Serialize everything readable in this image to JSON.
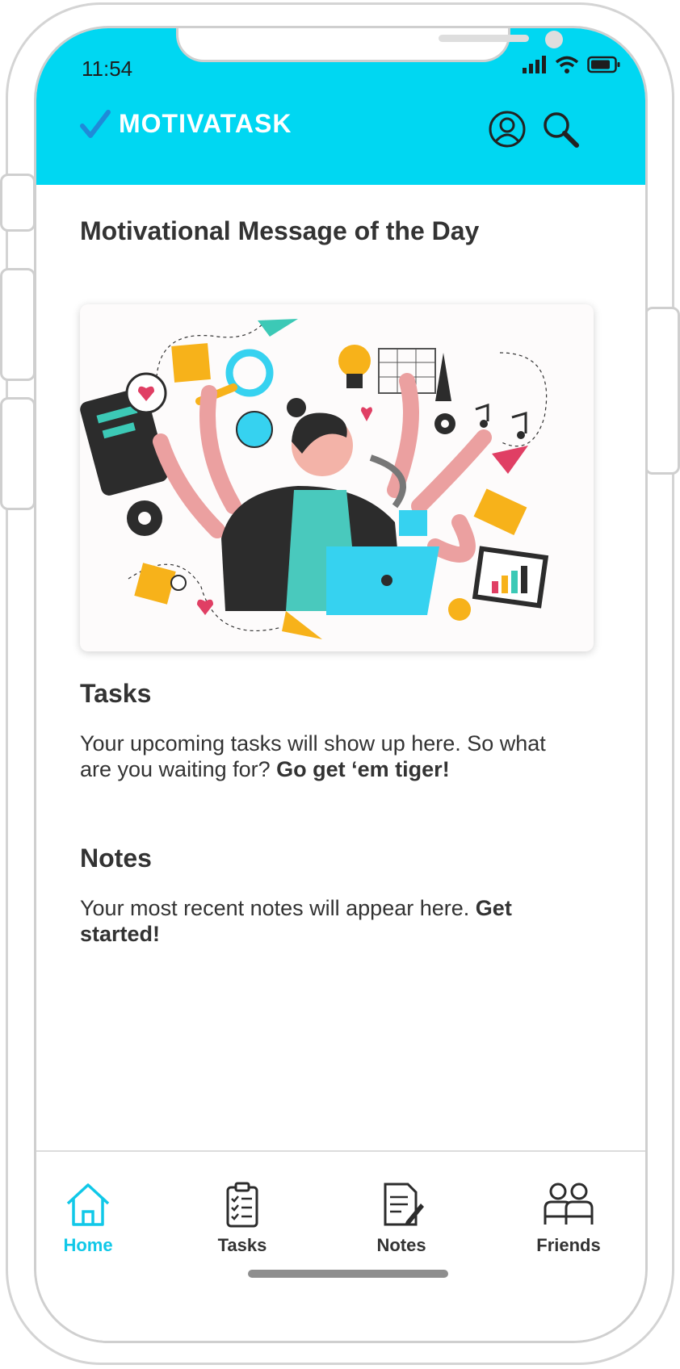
{
  "status_bar": {
    "time": "11:54"
  },
  "header": {
    "brand": "MOTIVATASK",
    "profile_icon": "user-circle-icon",
    "search_icon": "search-icon"
  },
  "main": {
    "motd_title": "Motivational Message of the Day",
    "illustration": "multitasking-woman-illustration",
    "tasks": {
      "title": "Tasks",
      "text": "Your upcoming tasks will show up here. So what are you waiting for?",
      "emphasis": "Go get ‘em tiger!"
    },
    "notes": {
      "title": "Notes",
      "text": "Your most recent notes will appear here.",
      "emphasis": "Get started!"
    }
  },
  "tabbar": {
    "items": [
      {
        "label": "Home",
        "icon": "home-icon",
        "active": true
      },
      {
        "label": "Tasks",
        "icon": "clipboard-checklist-icon",
        "active": false
      },
      {
        "label": "Notes",
        "icon": "note-pencil-icon",
        "active": false
      },
      {
        "label": "Friends",
        "icon": "friends-icon",
        "active": false
      }
    ]
  },
  "colors": {
    "accent": "#00d7f2",
    "active_tab": "#10c8e8",
    "check": "#1f8bd8"
  }
}
